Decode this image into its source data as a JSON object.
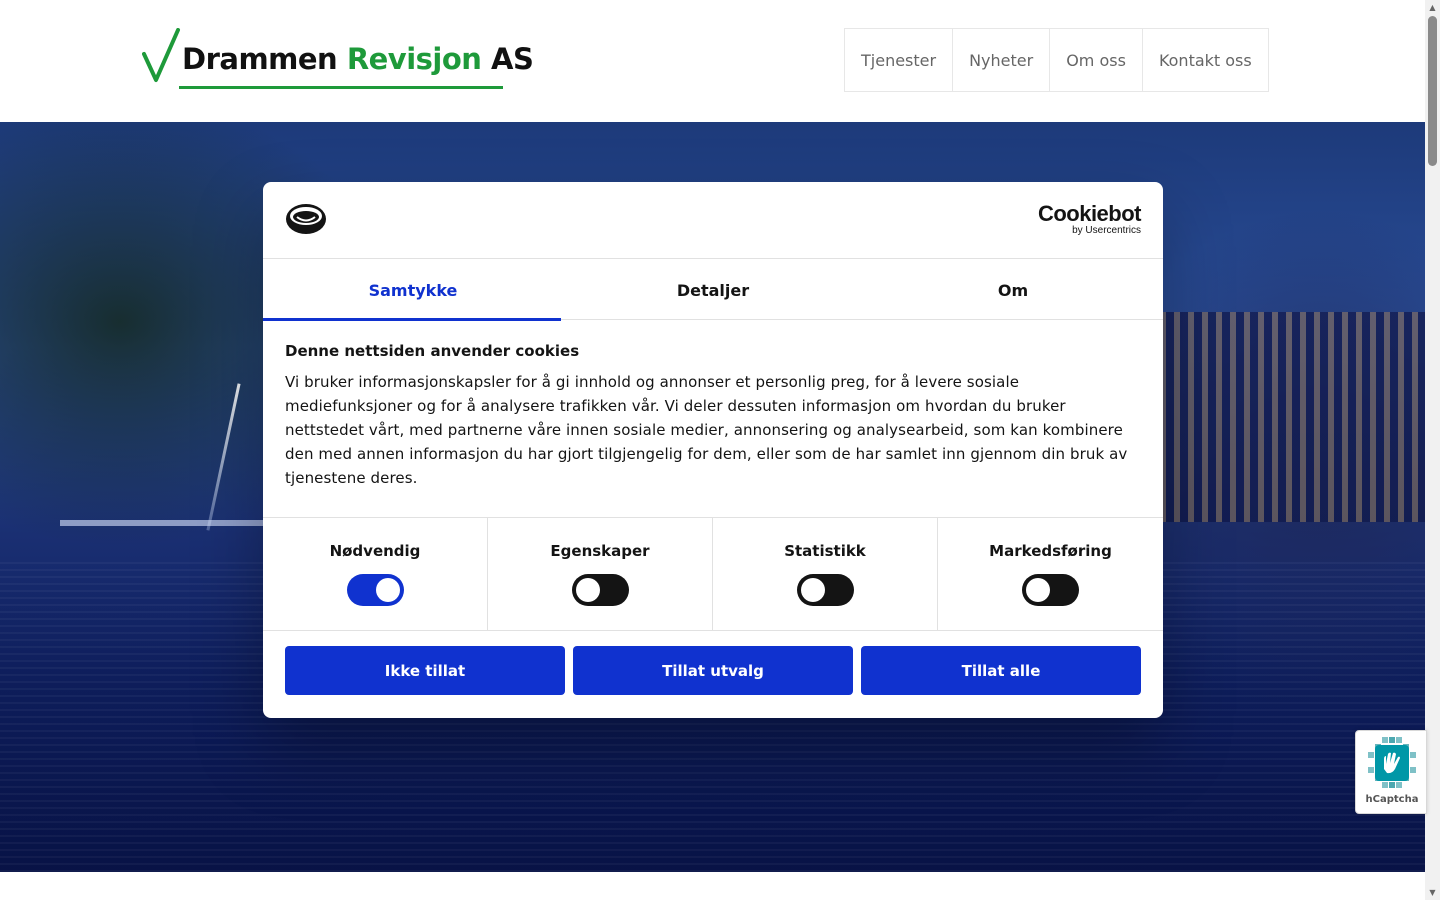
{
  "site": {
    "logo": {
      "word1": "Drammen",
      "word2": "Revisjon",
      "word3": "AS"
    },
    "nav": [
      {
        "label": "Tjenester"
      },
      {
        "label": "Nyheter"
      },
      {
        "label": "Om oss"
      },
      {
        "label": "Kontakt oss"
      }
    ]
  },
  "cookie_dialog": {
    "brand": {
      "name": "Cookiebot",
      "sub": "by Usercentrics"
    },
    "tabs": [
      {
        "label": "Samtykke",
        "active": true
      },
      {
        "label": "Detaljer",
        "active": false
      },
      {
        "label": "Om",
        "active": false
      }
    ],
    "title": "Denne nettsiden anvender cookies",
    "text": "Vi bruker informasjonskapsler for å gi innhold og annonser et personlig preg, for å levere sosiale mediefunksjoner og for å analysere trafikken vår. Vi deler dessuten informasjon om hvordan du bruker nettstedet vårt, med partnerne våre innen sosiale medier, annonsering og analysearbeid, som kan kombinere den med annen informasjon du har gjort tilgjengelig for dem, eller som de har samlet inn gjennom din bruk av tjenestene deres.",
    "toggles": [
      {
        "label": "Nødvendig",
        "checked": true
      },
      {
        "label": "Egenskaper",
        "checked": false
      },
      {
        "label": "Statistikk",
        "checked": false
      },
      {
        "label": "Markedsføring",
        "checked": false
      }
    ],
    "buttons": {
      "deny": "Ikke tillat",
      "allow_selection": "Tillat utvalg",
      "allow_all": "Tillat alle"
    }
  },
  "hcaptcha": {
    "label": "hCaptcha"
  },
  "colors": {
    "accent": "#1032cf",
    "logo_green": "#1e9a3a",
    "toggle_off": "#141414"
  }
}
